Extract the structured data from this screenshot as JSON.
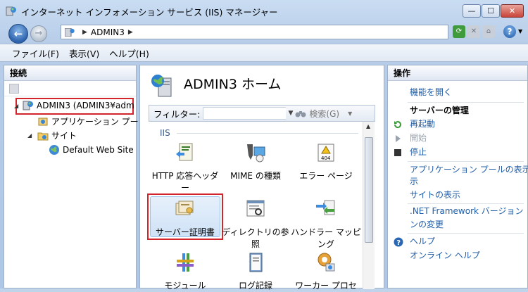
{
  "window": {
    "title": "インターネット インフォメーション サービス (IIS) マネージャー"
  },
  "address": {
    "separator": "▶",
    "crumb": "ADMIN3",
    "trail": "▶"
  },
  "menu": {
    "file": "ファイル(F)",
    "view": "表示(V)",
    "help": "ヘルプ(H)"
  },
  "left": {
    "header": "接続",
    "tree": {
      "server": "ADMIN3 (ADMIN3¥adm",
      "app_pools": "アプリケーション プー",
      "sites": "サイト",
      "default_site": "Default Web Site"
    }
  },
  "center": {
    "title": "ADMIN3 ホーム",
    "filter_label": "フィルター:",
    "filter_value": "",
    "search_label": "検索(G)",
    "section": "IIS",
    "tiles": [
      {
        "label": "HTTP 応答ヘッダー",
        "icon": "http-header-icon"
      },
      {
        "label": "MIME の種類",
        "icon": "mime-icon"
      },
      {
        "label": "エラー ページ",
        "icon": "error-page-icon"
      },
      {
        "label": "サーバー証明書",
        "icon": "certificate-icon"
      },
      {
        "label": "ディレクトリの参照",
        "icon": "directory-browse-icon"
      },
      {
        "label": "ハンドラー マッピング",
        "icon": "handler-mapping-icon"
      },
      {
        "label": "モジュール",
        "icon": "module-icon"
      },
      {
        "label": "ログ記録",
        "icon": "logging-icon"
      },
      {
        "label": "ワーカー プロセ",
        "icon": "worker-process-icon"
      }
    ]
  },
  "right": {
    "header": "操作",
    "open_feature": "機能を開く",
    "manage_server": "サーバーの管理",
    "restart": "再起動",
    "start": "開始",
    "stop": "停止",
    "view_app_pools_1": "アプリケーション プールの表示",
    "view_app_pools_2": "示",
    "view_sites": "サイトの表示",
    "net_version_1": ".NET Framework バージョン",
    "net_version_2": "ンの変更",
    "help": "ヘルプ",
    "online_help": "オンライン ヘルプ"
  },
  "colors": {
    "link": "#1f5ca8",
    "highlight_border": "#d1252b",
    "section": "#3b5a85"
  }
}
